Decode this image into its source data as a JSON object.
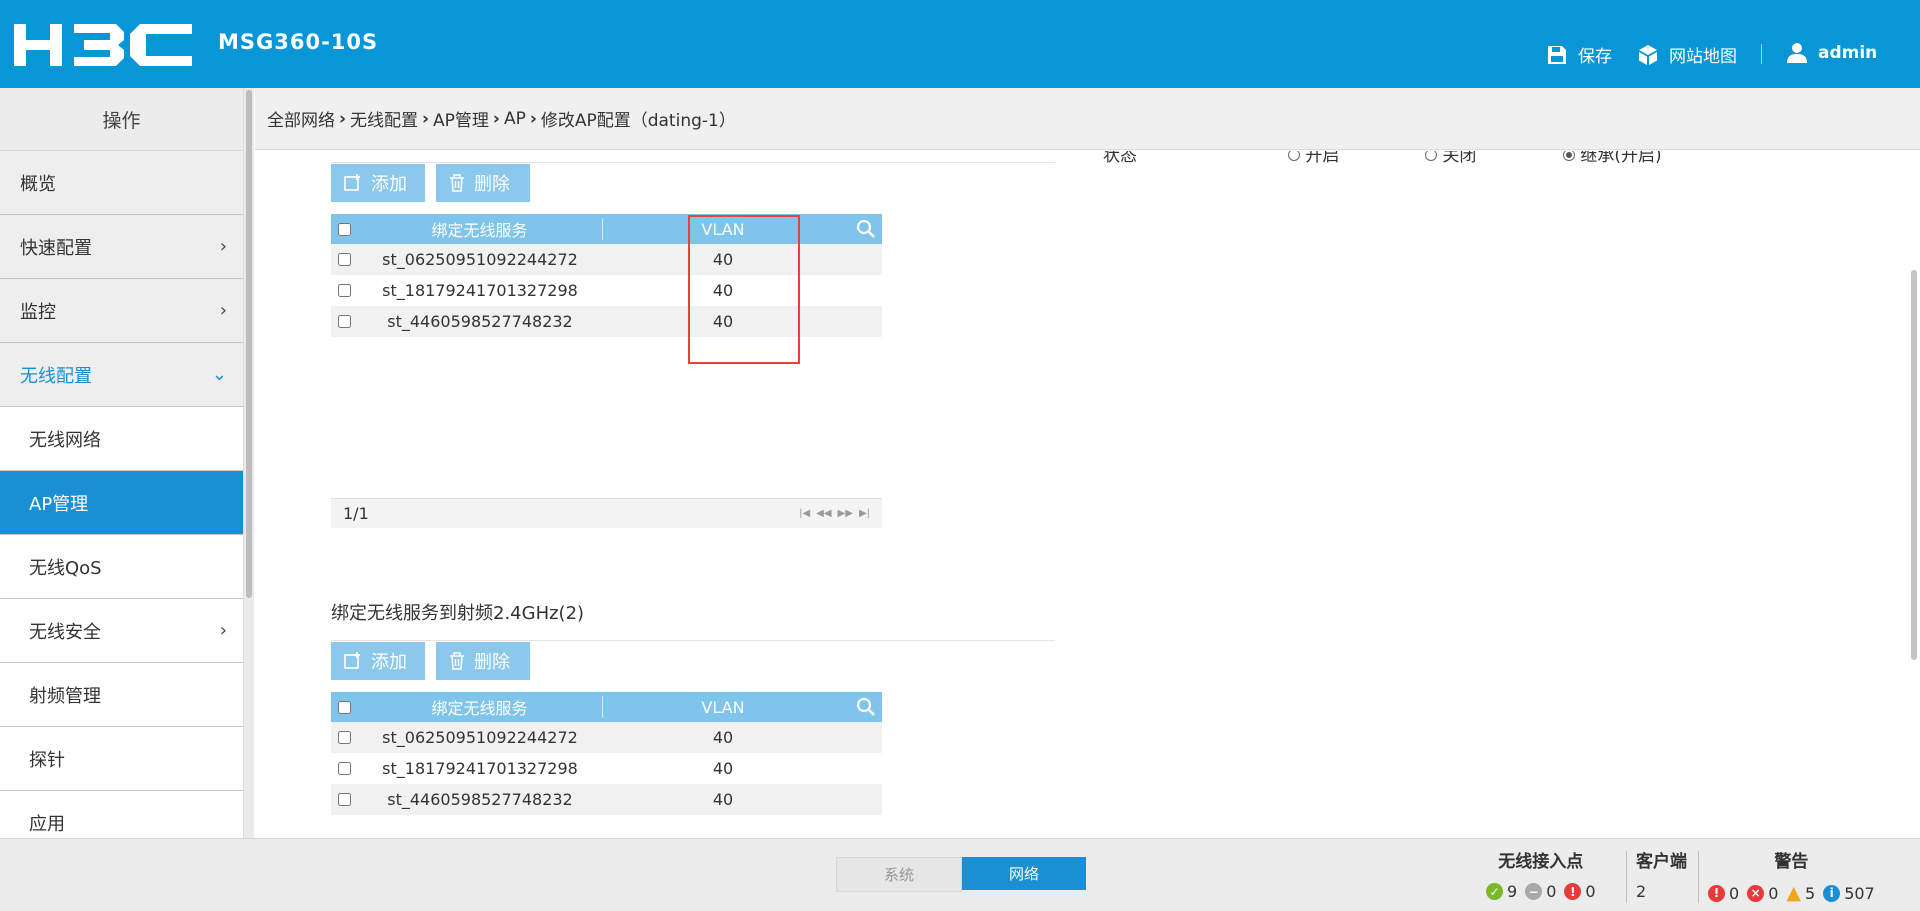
{
  "header": {
    "brand": "H3C",
    "model": "MSG360-10S",
    "save_label": "保存",
    "sitemap_label": "网站地图",
    "user_label": "admin"
  },
  "breadcrumb": [
    "全部网络",
    "无线配置",
    "AP管理",
    "AP",
    "修改AP配置（dating-1）"
  ],
  "sidebar": {
    "title": "操作",
    "items": [
      {
        "label": "概览",
        "chevron": "",
        "state": "normal"
      },
      {
        "label": "快速配置",
        "chevron": "›",
        "state": "normal"
      },
      {
        "label": "监控",
        "chevron": "›",
        "state": "normal"
      },
      {
        "label": "无线配置",
        "chevron": "⌄",
        "state": "expanded"
      },
      {
        "label": "无线网络",
        "chevron": "",
        "state": "sub"
      },
      {
        "label": "AP管理",
        "chevron": "",
        "state": "active"
      },
      {
        "label": "无线QoS",
        "chevron": "",
        "state": "sub"
      },
      {
        "label": "无线安全",
        "chevron": "›",
        "state": "sub"
      },
      {
        "label": "射频管理",
        "chevron": "",
        "state": "sub"
      },
      {
        "label": "探针",
        "chevron": "",
        "state": "sub"
      },
      {
        "label": "应用",
        "chevron": "",
        "state": "sub"
      }
    ]
  },
  "status_field": {
    "label": "状态",
    "options": [
      {
        "label": "开启",
        "checked": false
      },
      {
        "label": "关闭",
        "checked": false
      },
      {
        "label": "继承(开启)",
        "checked": true
      }
    ]
  },
  "toolbar": {
    "add_label": "添加",
    "delete_label": "删除"
  },
  "table1": {
    "columns": [
      "绑定无线服务",
      "VLAN"
    ],
    "rows": [
      {
        "service": "st_06250951092244272",
        "vlan": "40"
      },
      {
        "service": "st_18179241701327298",
        "vlan": "40"
      },
      {
        "service": "st_4460598527748232",
        "vlan": "40"
      }
    ],
    "pagination": "1/1"
  },
  "section2": {
    "title": "绑定无线服务到射频2.4GHz(2)"
  },
  "table2": {
    "columns": [
      "绑定无线服务",
      "VLAN"
    ],
    "rows": [
      {
        "service": "st_06250951092244272",
        "vlan": "40"
      },
      {
        "service": "st_18179241701327298",
        "vlan": "40"
      },
      {
        "service": "st_4460598527748232",
        "vlan": "40"
      }
    ]
  },
  "footer": {
    "modes": [
      "系统",
      "网络"
    ],
    "active_mode": "网络",
    "ap": {
      "title": "无线接入点",
      "online": "9",
      "idle": "0",
      "fault": "0"
    },
    "clients": {
      "title": "客户端",
      "count": "2"
    },
    "alerts": {
      "title": "警告",
      "critical": "0",
      "error": "0",
      "warning": "5",
      "info": "507"
    }
  },
  "colors": {
    "header_bg": "#0896d7",
    "active_nav": "#1a8fd3",
    "table_header": "#7fc4ea",
    "button_bg": "#8cc8ec",
    "highlight_box": "#e8413a"
  }
}
